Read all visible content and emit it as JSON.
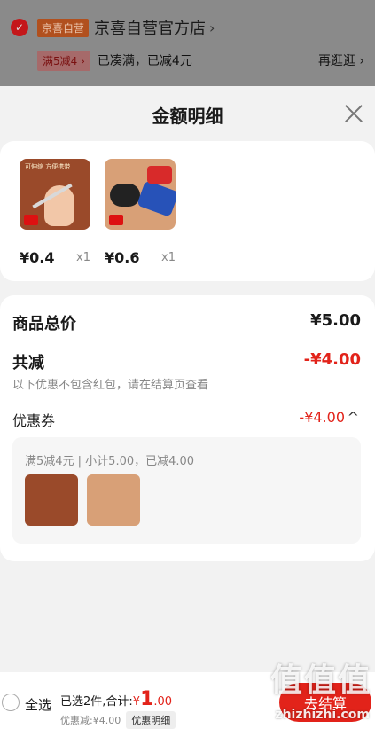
{
  "store": {
    "badge": "京喜自营",
    "name": "京喜自营官方店",
    "chevron": "›",
    "promo_tag": "满5减4 ›",
    "promo_text": "已凑满，已减4元",
    "go_shopping": "再逛逛 ›"
  },
  "sheet": {
    "title": "金额明细"
  },
  "items": [
    {
      "price": "¥0.4",
      "qty": "x1",
      "thumb_caption": "可伸缩 方便携带",
      "icon": "product-fork-icon"
    },
    {
      "price": "¥0.6",
      "qty": "x1",
      "thumb_caption": "",
      "icon": "product-tool-icon"
    }
  ],
  "summary": {
    "total_label": "商品总价",
    "total_value": "¥5.00",
    "discount_label": "共减",
    "discount_value": "-¥4.00",
    "discount_note": "以下优惠不包含红包，请在结算页查看",
    "coupon_label": "优惠券",
    "coupon_value": "-¥4.00",
    "coupon_chevron": "^",
    "coupon_detail": "满5减4元 | 小计5.00，已减4.00"
  },
  "bottom_bar": {
    "select_all": "全选",
    "selected_prefix": "已选2件,合计:",
    "currency": "¥",
    "amount_int": "1",
    "amount_dec": ".00",
    "discount_text": "优惠减:¥4.00",
    "detail_button": "优惠明细",
    "checkout_button": "去结算",
    "watermark": "值值值",
    "watermark_url": "zhizhizhi.com"
  },
  "colors": {
    "accent": "#e2231a",
    "overlay": "#8a8a8a",
    "page_bg": "#f2f2f2"
  }
}
